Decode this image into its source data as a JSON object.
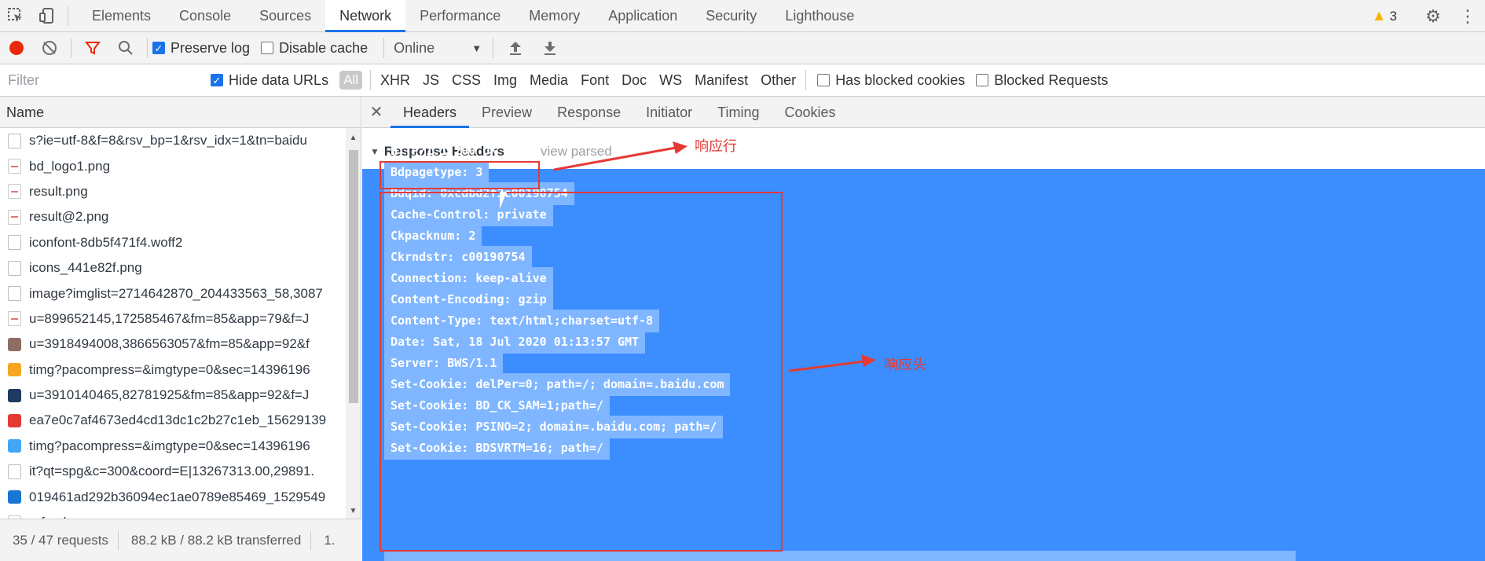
{
  "devtools": {
    "tabs": [
      "Elements",
      "Console",
      "Sources",
      "Network",
      "Performance",
      "Memory",
      "Application",
      "Security",
      "Lighthouse"
    ],
    "active_tab": "Network",
    "warning_count": "3"
  },
  "toolbar": {
    "preserve_log_label": "Preserve log",
    "disable_cache_label": "Disable cache",
    "throttling_value": "Online"
  },
  "filter": {
    "placeholder": "Filter",
    "hide_data_urls_label": "Hide data URLs",
    "all_label": "All",
    "types": [
      "XHR",
      "JS",
      "CSS",
      "Img",
      "Media",
      "Font",
      "Doc",
      "WS",
      "Manifest",
      "Other"
    ],
    "has_blocked_cookies_label": "Has blocked cookies",
    "blocked_requests_label": "Blocked Requests"
  },
  "requests": {
    "column_name": "Name",
    "rows": [
      "s?ie=utf-8&f=8&rsv_bp=1&rsv_idx=1&tn=baidu",
      "bd_logo1.png",
      "result.png",
      "result@2.png",
      "iconfont-8db5f471f4.woff2",
      "icons_441e82f.png",
      "image?imglist=2714642870_204433563_58,3087",
      "u=899652145,172585467&fm=85&app=79&f=J",
      "u=3918494008,3866563057&fm=85&app=92&f",
      "timg?pacompress=&imgtype=0&sec=14396196",
      "u=3910140465,82781925&fm=85&app=92&f=J",
      "ea7e0c7af4673ed4cd13dc1c2b27c1eb_15629139",
      "timg?pacompress=&imgtype=0&sec=14396196",
      "it?qt=spg&c=300&coord=E|13267313.00,29891.",
      "019461ad292b36094ec1ae0789e85469_1529549",
      "refresh.png"
    ],
    "status_requests": "35 / 47 requests",
    "status_transferred": "88.2 kB / 88.2 kB transferred",
    "status_more": "1."
  },
  "details": {
    "tabs": [
      "Headers",
      "Preview",
      "Response",
      "Initiator",
      "Timing",
      "Cookies"
    ],
    "active_tab": "Headers",
    "section_title": "Response Headers",
    "view_parsed": "view parsed",
    "status_line": "HTTP/1.1 200 OK",
    "headers": [
      "Bdpagetype: 3",
      "Bdqid: 0xcdbd2f3c00190754",
      "Cache-Control: private",
      "Ckpacknum: 2",
      "Ckrndstr: c00190754",
      "Connection: keep-alive",
      "Content-Encoding: gzip",
      "Content-Type: text/html;charset=utf-8",
      "Date: Sat, 18 Jul 2020 01:13:57 GMT",
      "Server: BWS/1.1",
      "Set-Cookie: delPer=0; path=/; domain=.baidu.com",
      "Set-Cookie: BD_CK_SAM=1;path=/",
      "Set-Cookie: PSINO=2; domain=.baidu.com; path=/",
      "Set-Cookie: BDSVRTM=16; path=/"
    ]
  },
  "annotations": {
    "response_line_label": "响应行",
    "response_headers_label": "响应头"
  },
  "colors": {
    "accent": "#1a73e8",
    "selection": "#3c8eff",
    "annotation": "#e53935",
    "record": "#e8290b"
  }
}
